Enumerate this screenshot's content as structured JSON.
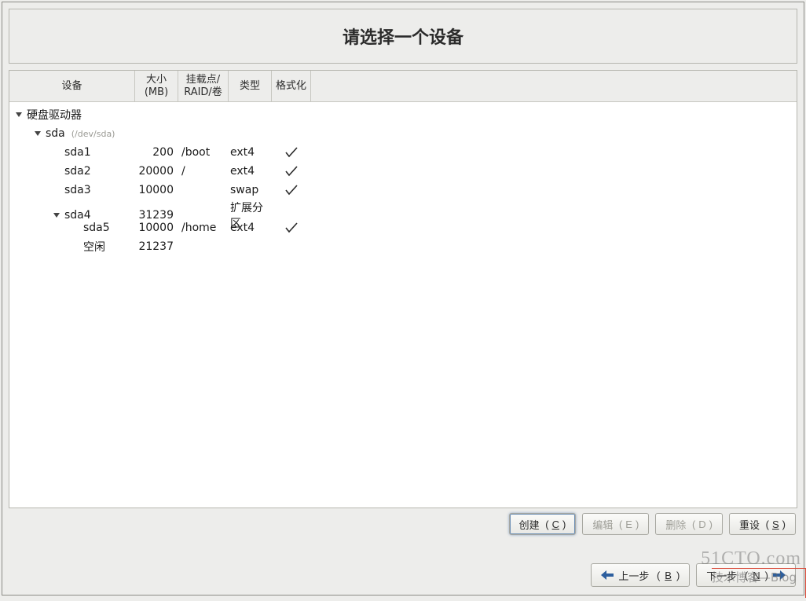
{
  "title": "请选择一个设备",
  "columns": {
    "device": "设备",
    "size": "大小\n(MB)",
    "mount": "挂载点/\nRAID/卷",
    "type": "类型",
    "format": "格式化"
  },
  "tree": {
    "root_label": "硬盘驱动器",
    "disk": {
      "name": "sda",
      "path": "(/dev/sda)"
    },
    "rows": [
      {
        "dev": "sda1",
        "size": "200",
        "mount": "/boot",
        "type": "ext4",
        "format": true,
        "indent": 2,
        "expander": null
      },
      {
        "dev": "sda2",
        "size": "20000",
        "mount": "/",
        "type": "ext4",
        "format": true,
        "indent": 2,
        "expander": null
      },
      {
        "dev": "sda3",
        "size": "10000",
        "mount": "",
        "type": "swap",
        "format": true,
        "indent": 2,
        "expander": null
      },
      {
        "dev": "sda4",
        "size": "31239",
        "mount": "",
        "type": "扩展分区",
        "format": false,
        "indent": 2,
        "expander": "open"
      },
      {
        "dev": "sda5",
        "size": "10000",
        "mount": "/home",
        "type": "ext4",
        "format": true,
        "indent": 3,
        "expander": null
      },
      {
        "dev": "空闲",
        "size": "21237",
        "mount": "",
        "type": "",
        "format": false,
        "indent": 3,
        "expander": null
      }
    ]
  },
  "buttons": {
    "create": "创建",
    "create_key": "C",
    "edit": "编辑",
    "edit_key": "E",
    "delete": "删除",
    "delete_key": "D",
    "reset": "重设",
    "reset_key": "S",
    "back": "上一步",
    "back_key": "B",
    "next": "下一步",
    "next_key": "N"
  },
  "watermark": {
    "line1": "51CTO.com",
    "line2": "技术博客—Blog"
  }
}
